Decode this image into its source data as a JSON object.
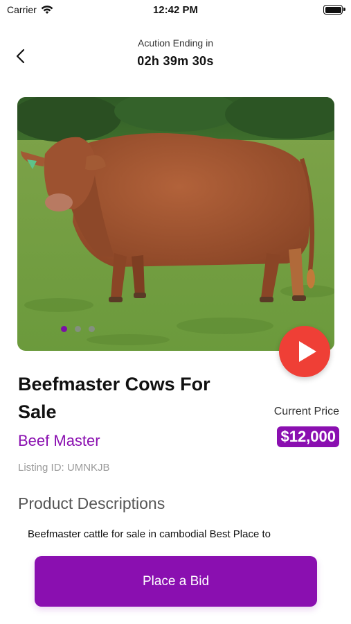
{
  "status_bar": {
    "carrier": "Carrier",
    "time": "12:42 PM"
  },
  "header": {
    "subtitle": "Acution Ending in",
    "countdown": "02h 39m 30s"
  },
  "gallery": {
    "dot_count": 3,
    "active_index": 0
  },
  "product": {
    "title": "Beefmaster Cows For Sale",
    "breed": "Beef Master",
    "listing_id": "Listing ID: UMNKJB",
    "price_label": "Current Price",
    "price": "$12,000"
  },
  "description": {
    "heading": "Product Descriptions",
    "text": "Beefmaster cattle for sale in cambodial Best Place to"
  },
  "actions": {
    "bid_label": "Place a Bid"
  },
  "colors": {
    "accent": "#8a0fb0",
    "play": "#ef3f36"
  }
}
